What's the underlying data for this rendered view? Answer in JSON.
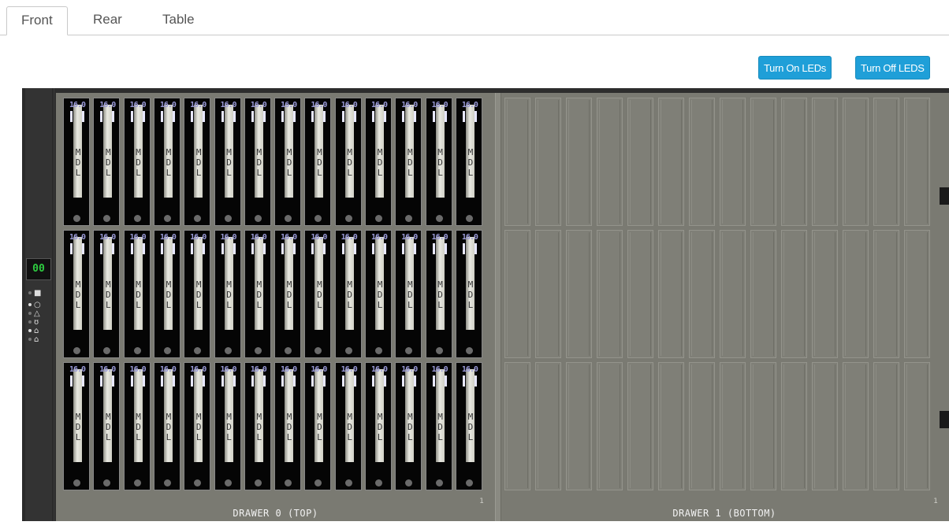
{
  "tabs": [
    {
      "label": "Front",
      "active": true
    },
    {
      "label": "Rear",
      "active": false
    },
    {
      "label": "Table",
      "active": false
    }
  ],
  "actions": {
    "leds_on_label": "Turn On LEDs",
    "leds_off_label": "Turn Off LEDS"
  },
  "enclosure": {
    "display_code": "00",
    "indicators": [
      {
        "icon": "power-icon",
        "glyph": "○",
        "lit": true
      },
      {
        "icon": "warning-icon",
        "glyph": "△",
        "lit": false
      },
      {
        "icon": "lock-icon",
        "glyph": "ʊ",
        "lit": false
      },
      {
        "icon": "service-icon",
        "glyph": "⌂",
        "lit": true
      },
      {
        "icon": "wrench-icon",
        "glyph": "⌂",
        "lit": false
      }
    ],
    "drawers": [
      {
        "label": "DRAWER 0 (TOP)",
        "mark": "1"
      },
      {
        "label": "DRAWER 1 (BOTTOM)",
        "mark": "1"
      }
    ],
    "disk_capacity_label": "16.0",
    "disk_type_letters": [
      "M",
      "D",
      "L"
    ],
    "colors": {
      "accent": "#1f9fd8",
      "segment_display": "#2ecc40",
      "disk_cap": "#9a9ad8"
    }
  }
}
